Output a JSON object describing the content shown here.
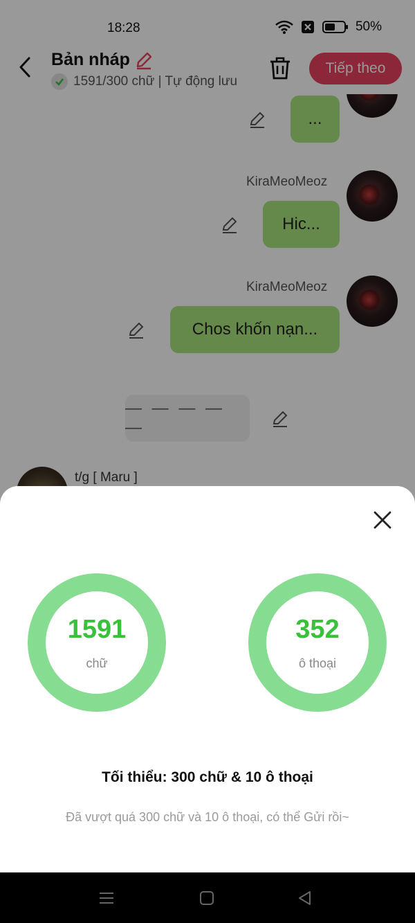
{
  "status_bar": {
    "time": "18:28",
    "battery": "50%",
    "icons": [
      "wifi-icon",
      "sim-off-icon",
      "battery-icon"
    ]
  },
  "header": {
    "title": "Bản nháp",
    "word_status": "1591/300 chữ | Tự động lưu",
    "next_label": "Tiếp theo",
    "accent_color": "#e8425f",
    "icons": [
      "back-icon",
      "pencil-icon",
      "check-icon",
      "trash-icon"
    ]
  },
  "chat": {
    "messages": [
      {
        "user": "",
        "text": "..."
      },
      {
        "user": "KiraMeoMeoz",
        "text": "Hic..."
      },
      {
        "user": "KiraMeoMeoz",
        "text": "Chos khốn nạn..."
      }
    ],
    "divider_text": "— — — — —",
    "bottom_user": "t/g [ Maru ]",
    "bubble_color": "#a9e57d"
  },
  "sheet": {
    "stats": [
      {
        "value": "1591",
        "label": "chữ"
      },
      {
        "value": "352",
        "label": "ô thoại"
      }
    ],
    "minimum_title": "Tối thiểu: 300 chữ & 10 ô thoại",
    "minimum_desc": "Đã vượt quá 300 chữ và 10 ô thoại, có thể Gửi rồi~",
    "ring_color": "#86dc90",
    "value_color": "#3ac13b"
  },
  "nav_bar": {
    "icons": [
      "menu-icon",
      "home-icon",
      "back-triangle-icon"
    ]
  }
}
